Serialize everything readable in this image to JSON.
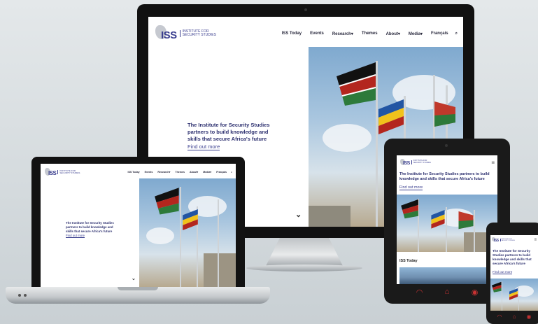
{
  "site": {
    "logo_mark": "ISS",
    "logo_name_line1": "Institute for",
    "logo_name_line2": "Security Studies",
    "nav": {
      "iss_today": "ISS Today",
      "events": "Events",
      "research": "Research",
      "themes": "Themes",
      "about": "About",
      "media": "Media",
      "francais": "Français"
    },
    "hero_line1": "The Institute for Security Studies",
    "hero_line2": "partners to build knowledge and",
    "hero_line3": "skills that secure Africa's future",
    "hero_full": "The Institute for Security Studies partners to build knowledge and skills that secure Africa's future",
    "cta": "Find out more",
    "section_iss_today": "ISS Today"
  },
  "icons": {
    "search": "⌕",
    "caret": "▾",
    "chevron_down": "⌄",
    "menu": "≡",
    "back": "◠",
    "home": "⌂",
    "recent": "◉"
  },
  "colors": {
    "brand_navy": "#3b3f8f",
    "hero_text": "#2e3170",
    "softkey_red": "#c73232"
  }
}
